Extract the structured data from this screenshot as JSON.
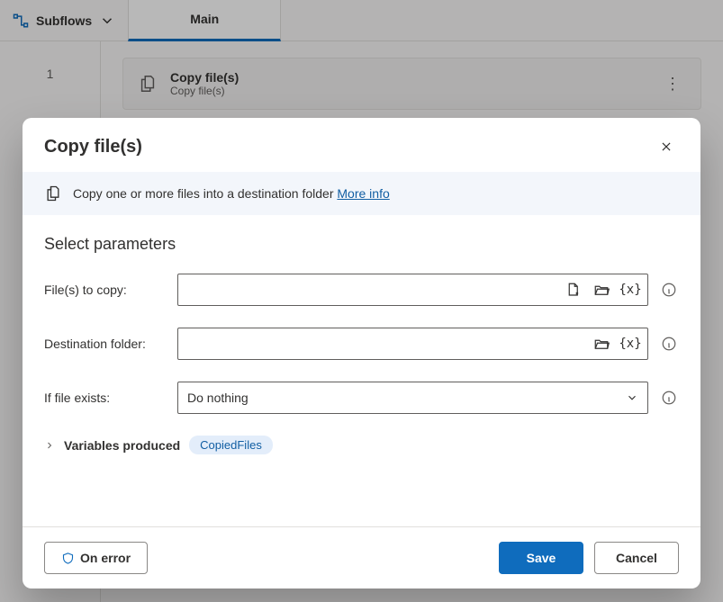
{
  "toolbar": {
    "subflows_label": "Subflows",
    "tab_main": "Main"
  },
  "canvas": {
    "step_number": "1",
    "step_title": "Copy file(s)",
    "step_subtitle": "Copy file(s)"
  },
  "dialog": {
    "title": "Copy file(s)",
    "info_text": "Copy one or more files into a destination folder",
    "more_info": "More info",
    "section_title": "Select parameters",
    "labels": {
      "files_to_copy": "File(s) to copy:",
      "destination_folder": "Destination folder:",
      "if_file_exists": "If file exists:"
    },
    "values": {
      "files_to_copy": "",
      "destination_folder": "",
      "if_file_exists": "Do nothing"
    },
    "variables_produced_label": "Variables produced",
    "variable_chip": "CopiedFiles",
    "buttons": {
      "on_error": "On error",
      "save": "Save",
      "cancel": "Cancel"
    }
  },
  "icons": {
    "var_glyph": "{x}"
  }
}
